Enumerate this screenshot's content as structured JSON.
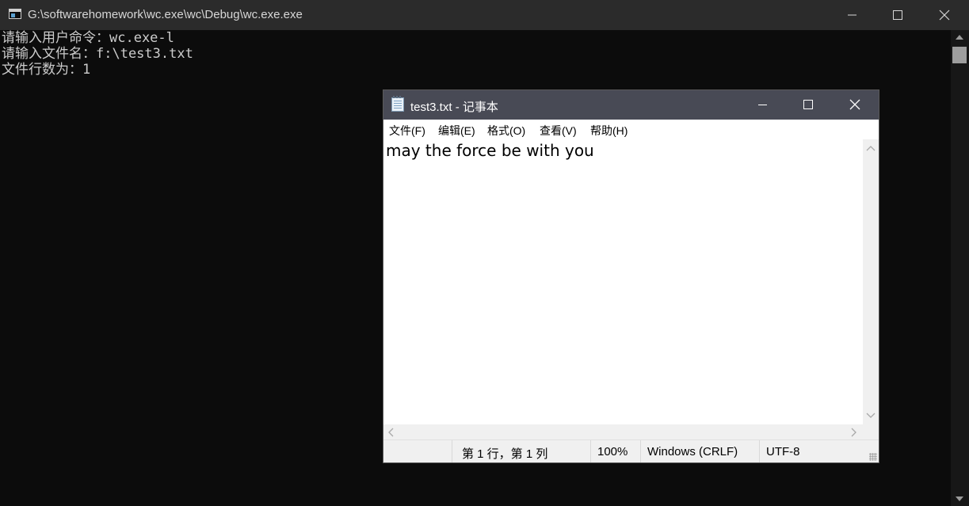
{
  "console": {
    "title": "G:\\softwarehomework\\wc.exe\\wc\\Debug\\wc.exe.exe",
    "lines": [
      "请输入用户命令：wc.exe-l",
      "请输入文件名：f:\\test3.txt",
      "文件行数为：1"
    ]
  },
  "notepad": {
    "title": "test3.txt - 记事本",
    "menu": [
      "文件(F)",
      "编辑(E)",
      "格式(O)",
      "查看(V)",
      "帮助(H)"
    ],
    "content": "may the force be with you",
    "status": {
      "position": "第 1 行，第 1 列",
      "zoom": "100%",
      "line_ending": "Windows (CRLF)",
      "encoding": "UTF-8"
    }
  },
  "colors": {
    "console_bg": "#0c0c0c",
    "console_text": "#cccccc",
    "notepad_titlebar": "#484a55"
  },
  "icons": {
    "console": "console-window-icon",
    "notepad": "notepad-icon",
    "minimize": "minimize-icon",
    "maximize": "maximize-icon",
    "close": "close-icon"
  }
}
